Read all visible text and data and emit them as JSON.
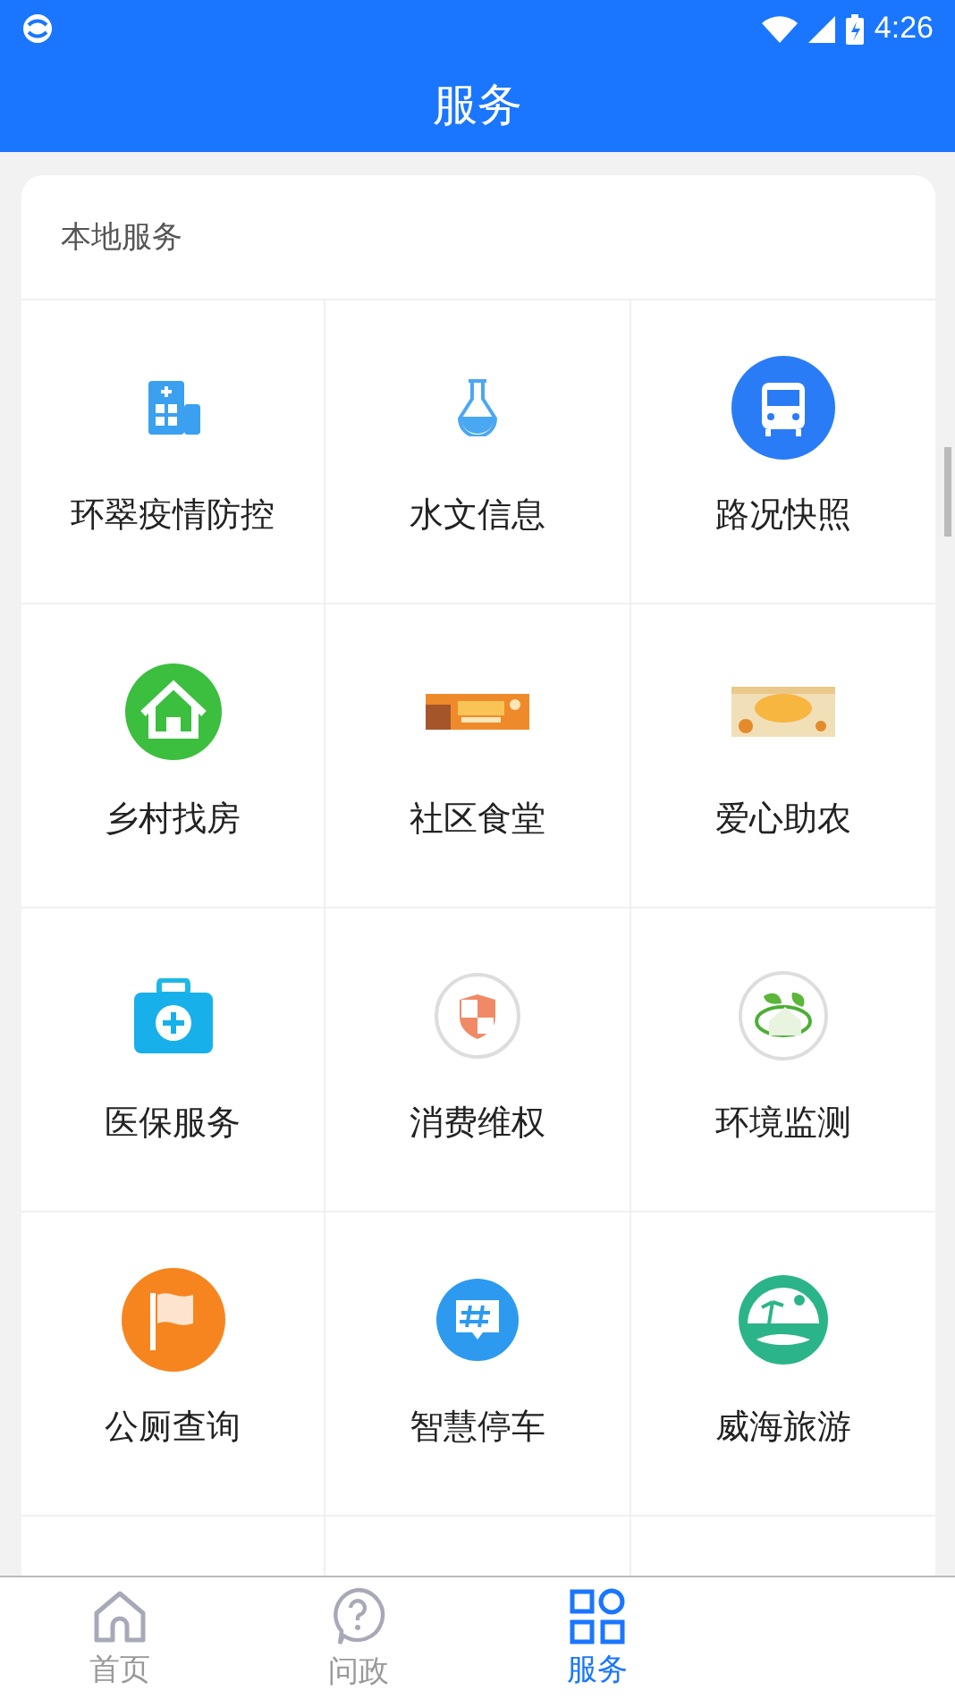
{
  "status_bar": {
    "time": "4:26"
  },
  "header": {
    "title": "服务"
  },
  "section": {
    "title": "本地服务",
    "services": [
      {
        "label": "环翠疫情防控"
      },
      {
        "label": "水文信息"
      },
      {
        "label": "路况快照"
      },
      {
        "label": "乡村找房"
      },
      {
        "label": "社区食堂"
      },
      {
        "label": "爱心助农"
      },
      {
        "label": "医保服务"
      },
      {
        "label": "消费维权"
      },
      {
        "label": "环境监测"
      },
      {
        "label": "公厕查询"
      },
      {
        "label": "智慧停车"
      },
      {
        "label": "威海旅游"
      }
    ]
  },
  "tabs": [
    {
      "label": "首页",
      "selected": false
    },
    {
      "label": "问政",
      "selected": false
    },
    {
      "label": "服务",
      "selected": true
    }
  ]
}
